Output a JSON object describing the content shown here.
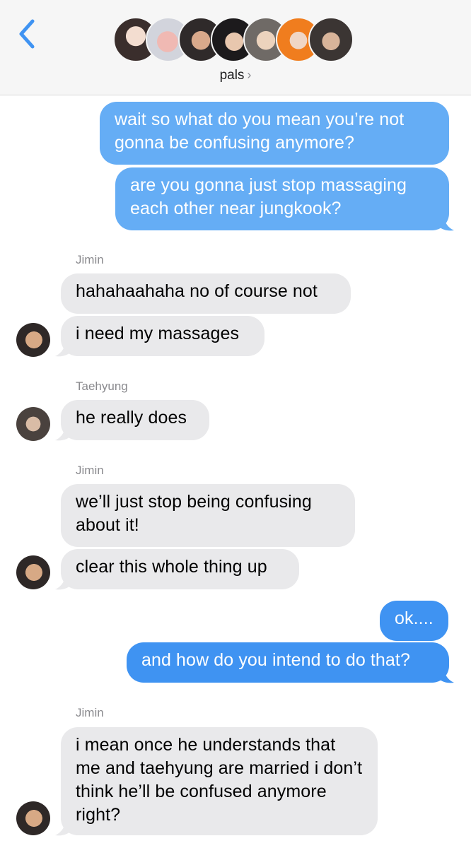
{
  "header": {
    "group_name": "pals",
    "chevron": "›",
    "back_icon": "chevron-left-icon",
    "accent_color": "#3f93f2",
    "members": [
      {
        "icon": "member-avatar-1"
      },
      {
        "icon": "member-avatar-2"
      },
      {
        "icon": "member-avatar-3"
      },
      {
        "icon": "member-avatar-4"
      },
      {
        "icon": "member-avatar-5"
      },
      {
        "icon": "member-avatar-6"
      },
      {
        "icon": "member-avatar-7"
      }
    ]
  },
  "colors": {
    "outgoing": "#3f93f2",
    "outgoing_light": "#65adf5",
    "incoming": "#e9e9eb"
  },
  "messages": [
    {
      "from": "me",
      "text": "wait so what do you mean you’re not gonna be confusing anymore?"
    },
    {
      "from": "me",
      "text": "are you gonna just stop massaging each other near jungkook?"
    },
    {
      "from": "Jimin",
      "sender_label": "Jimin",
      "text": "hahahaahaha no of course not"
    },
    {
      "from": "Jimin",
      "text": "i need my massages"
    },
    {
      "from": "Taehyung",
      "sender_label": "Taehyung",
      "text": "he really does"
    },
    {
      "from": "Jimin",
      "sender_label": "Jimin",
      "text": "we’ll just stop being confusing about it!"
    },
    {
      "from": "Jimin",
      "text": "clear this whole thing up"
    },
    {
      "from": "me",
      "text": "ok...."
    },
    {
      "from": "me",
      "text": "and how do you intend to do that?"
    },
    {
      "from": "Jimin",
      "sender_label": "Jimin",
      "text": "i mean once he understands that me and taehyung are married i don’t think he’ll be confused anymore right?"
    }
  ]
}
